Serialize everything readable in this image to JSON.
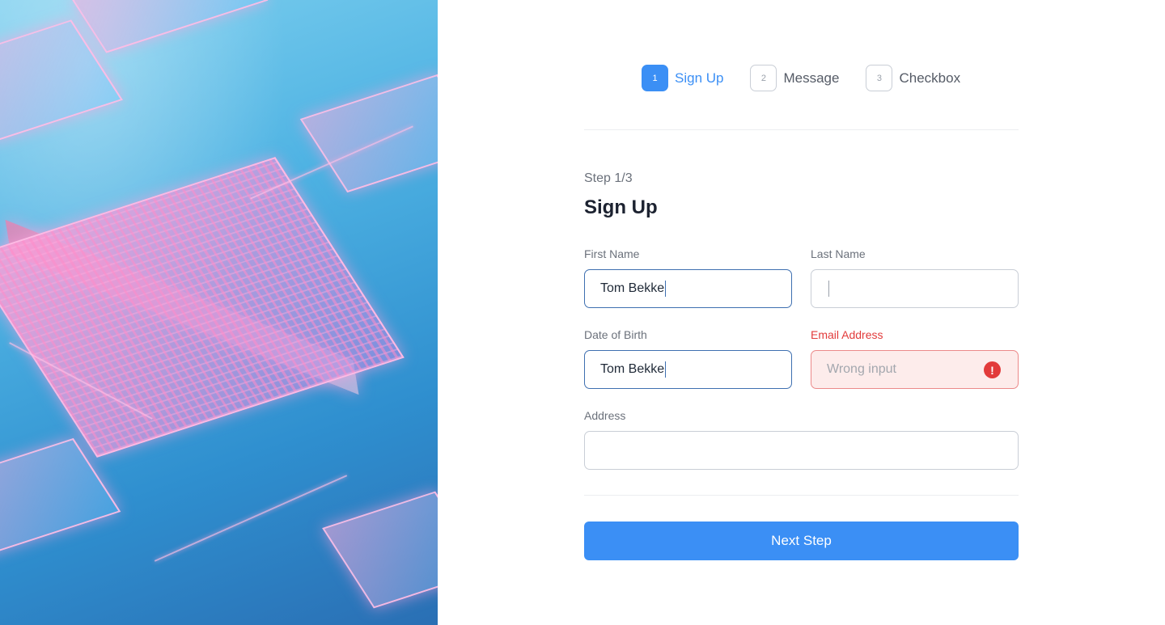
{
  "stepper": {
    "steps": [
      {
        "number": "1",
        "label": "Sign Up",
        "active": true
      },
      {
        "number": "2",
        "label": "Message",
        "active": false
      },
      {
        "number": "3",
        "label": "Checkbox",
        "active": false
      }
    ]
  },
  "form": {
    "step_caption": "Step 1/3",
    "title": "Sign Up",
    "fields": {
      "first_name": {
        "label": "First Name",
        "value": "Tom Bekke"
      },
      "last_name": {
        "label": "Last Name",
        "value": ""
      },
      "date_of_birth": {
        "label": "Date of Birth",
        "value": "Tom Bekke"
      },
      "email": {
        "label": "Email Address",
        "value": "Wrong input",
        "error_icon": "!"
      },
      "address": {
        "label": "Address",
        "value": ""
      }
    },
    "next_label": "Next Step"
  },
  "colors": {
    "accent": "#3b8ff5",
    "error": "#e23b3b",
    "error_bg": "#fdeceb"
  },
  "icons": {
    "error": "exclamation-circle-icon"
  }
}
